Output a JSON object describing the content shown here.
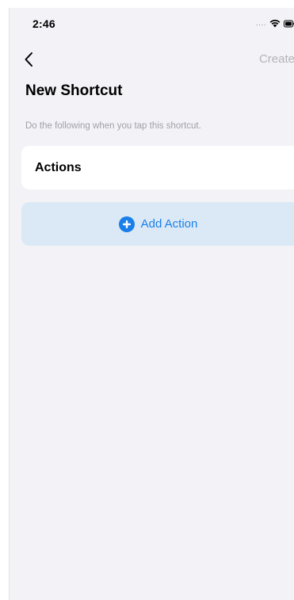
{
  "status_bar": {
    "time": "2:46",
    "signal_icon": "signal-dots-icon",
    "wifi_icon": "wifi-icon",
    "battery_icon": "battery-icon"
  },
  "nav": {
    "back_icon": "chevron-left-icon",
    "create_label": "Create"
  },
  "page": {
    "title": "New Shortcut",
    "subtitle": "Do the following when you tap this shortcut."
  },
  "actions_card": {
    "label": "Actions"
  },
  "add_action": {
    "icon": "plus-circle-icon",
    "label": "Add Action"
  },
  "colors": {
    "background": "#f2f2f7",
    "card": "#ffffff",
    "add_action_bg": "#dbe9f7",
    "accent": "#1a7fe8",
    "disabled_text": "#b3b3b8",
    "secondary_text": "#a0a0a6"
  }
}
